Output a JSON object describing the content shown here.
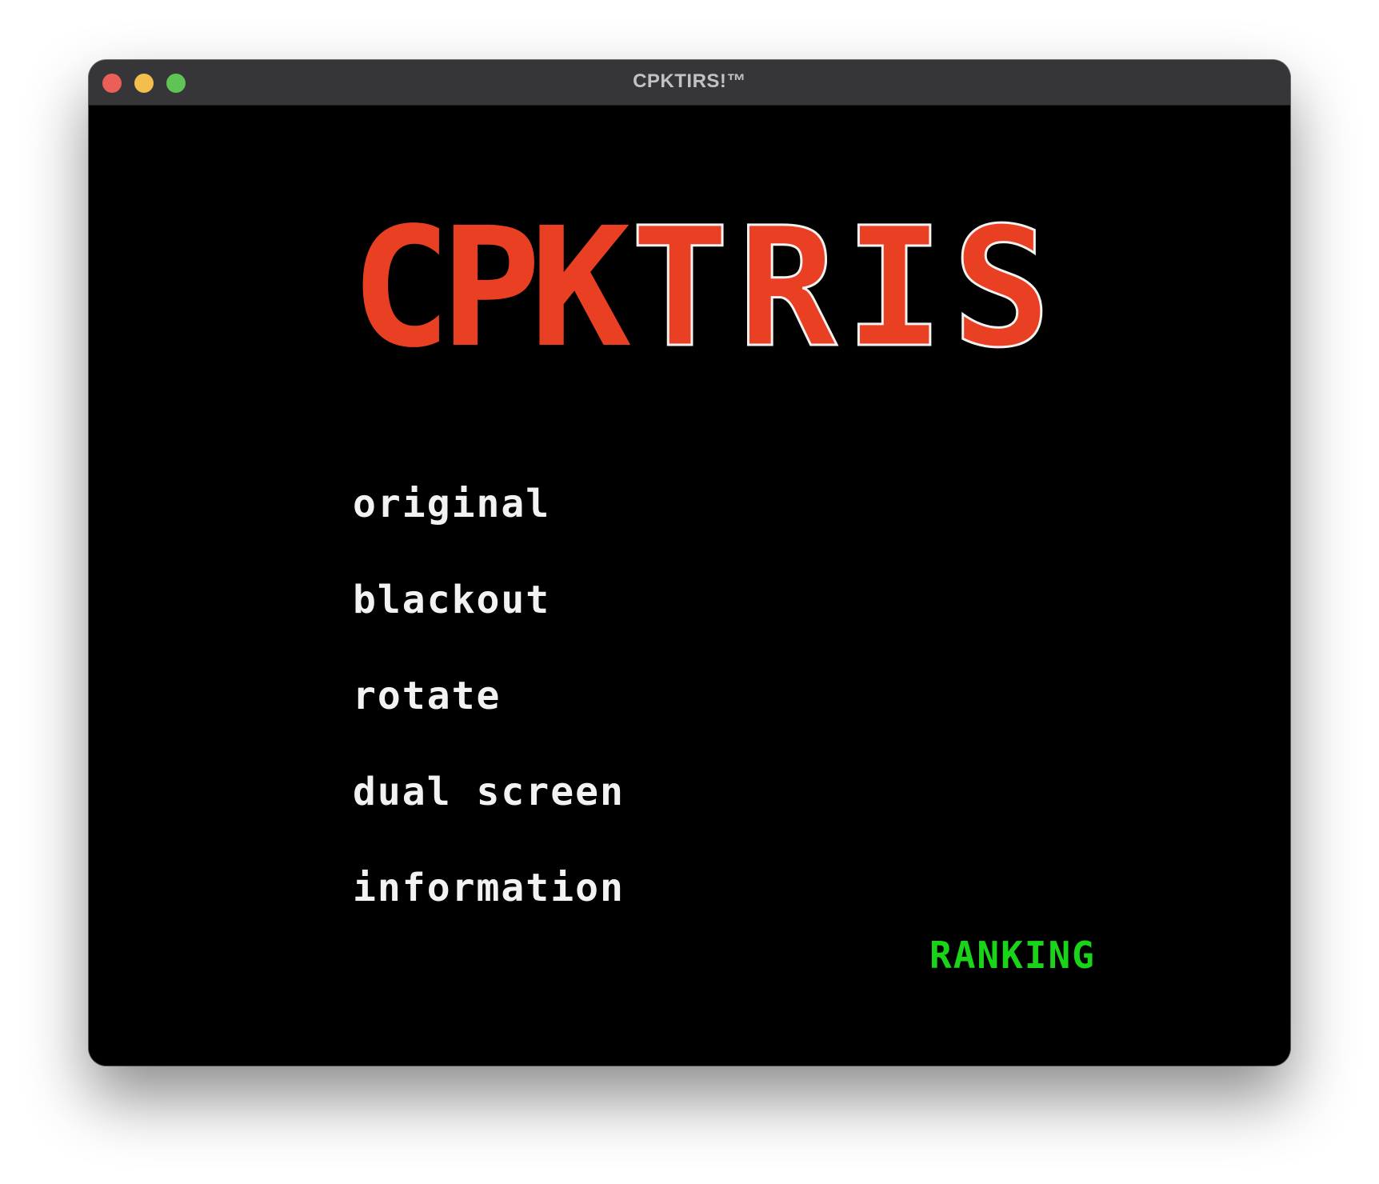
{
  "window": {
    "title": "CPKTIRS!™"
  },
  "logo": {
    "part_a": "CPK",
    "part_b": "TRIS",
    "color": "#e94024",
    "outline_color": "#f2f2f2"
  },
  "menu": {
    "items": [
      {
        "label": "original"
      },
      {
        "label": "blackout"
      },
      {
        "label": "rotate"
      },
      {
        "label": "dual screen"
      },
      {
        "label": "information"
      }
    ],
    "text_color": "#f2f2f2"
  },
  "ranking": {
    "label": "RANKING",
    "color": "#1ad41a"
  },
  "icons": {
    "close": "close-traffic-light-icon",
    "minimize": "minimize-traffic-light-icon",
    "zoom": "zoom-traffic-light-icon"
  }
}
